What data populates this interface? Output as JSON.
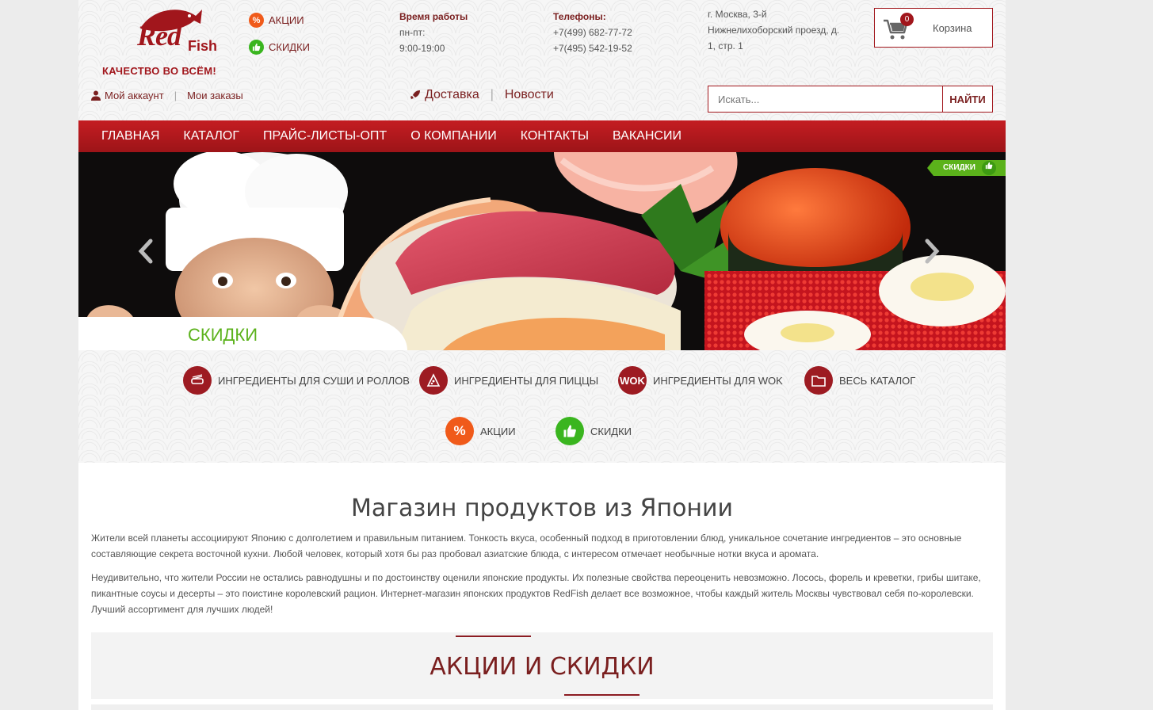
{
  "brand": {
    "logo_red": "Red",
    "logo_fish": "Fish",
    "tagline": "КАЧЕСТВО ВО ВСЁМ!"
  },
  "header": {
    "promo_links": [
      {
        "label": "АКЦИИ",
        "icon": "percent-icon"
      },
      {
        "label": "СКИДКИ",
        "icon": "thumbs-up-icon"
      }
    ],
    "hours": {
      "title": "Время работы",
      "days": "пн-пт:",
      "time": "9:00-19:00"
    },
    "phones": {
      "title": "Телефоны:",
      "phone1": "+7(499) 682-77-72",
      "phone2": "+7(495) 542-19-52"
    },
    "address": {
      "line1": "г. Москва, 3-й",
      "line2": "Нижнелихоборский проезд, д.",
      "line3": "1, стр. 1"
    },
    "cart": {
      "count": "0",
      "label": "Корзина"
    },
    "account": {
      "my_account": "Мой аккаунт",
      "my_orders": "Мои заказы"
    },
    "mid_links": {
      "delivery": "Доставка",
      "news": "Новости"
    },
    "search": {
      "placeholder": "Искать...",
      "button": "НАЙТИ"
    }
  },
  "nav": [
    "ГЛАВНАЯ",
    "КАТАЛОГ",
    "ПРАЙС-ЛИСТЫ-ОПТ",
    "О КОМПАНИИ",
    "КОНТАКТЫ",
    "ВАКАНСИИ"
  ],
  "hero": {
    "caption": "СКИДКИ",
    "ribbon": "СКИДКИ"
  },
  "categories": [
    {
      "label": "ИНГРЕДИЕНТЫ ДЛЯ СУШИ И РОЛЛОВ",
      "icon": "sushi-icon"
    },
    {
      "label": "ИНГРЕДИЕНТЫ ДЛЯ ПИЦЦЫ",
      "icon": "pizza-icon"
    },
    {
      "label": "ИНГРЕДИЕНТЫ ДЛЯ WOK",
      "icon": "wok-icon",
      "icon_text": "wok"
    },
    {
      "label": "ВЕСЬ КАТАЛОГ",
      "icon": "folder-icon"
    },
    {
      "label": "АКЦИИ",
      "icon": "percent-icon",
      "icon_text": "%"
    },
    {
      "label": "СКИДКИ",
      "icon": "thumbs-up-icon"
    }
  ],
  "content": {
    "title": "Магазин продуктов из Японии",
    "paragraph1": "Жители всей планеты ассоциируют Японию с долголетием и правильным питанием. Тонкость вкуса, особенный подход в приготовлении блюд, уникальное сочетание ингредиентов – это основные составляющие секрета восточной кухни. Любой человек, который хотя бы раз пробовал азиатские блюда, с интересом отмечает необычные нотки вкуса и аромата.",
    "paragraph2": "Неудивительно, что жители России не остались равнодушны и по достоинству оценили японские продукты. Их полезные свойства переоценить невозможно. Лосось, форель и креветки, грибы шитаке, пикантные соусы и десерты – это поистине королевский рацион. Интернет-магазин японских продуктов RedFish делает все возможное, чтобы каждый житель Москвы чувствовал себя по-королевски. Лучший ассортимент для лучших людей!",
    "promo_title": "АКЦИИ И СКИДКИ"
  },
  "colors": {
    "brand_red": "#a1161c",
    "nav_red": "#c41d22",
    "green": "#5bb21b",
    "orange": "#f05a1a"
  }
}
